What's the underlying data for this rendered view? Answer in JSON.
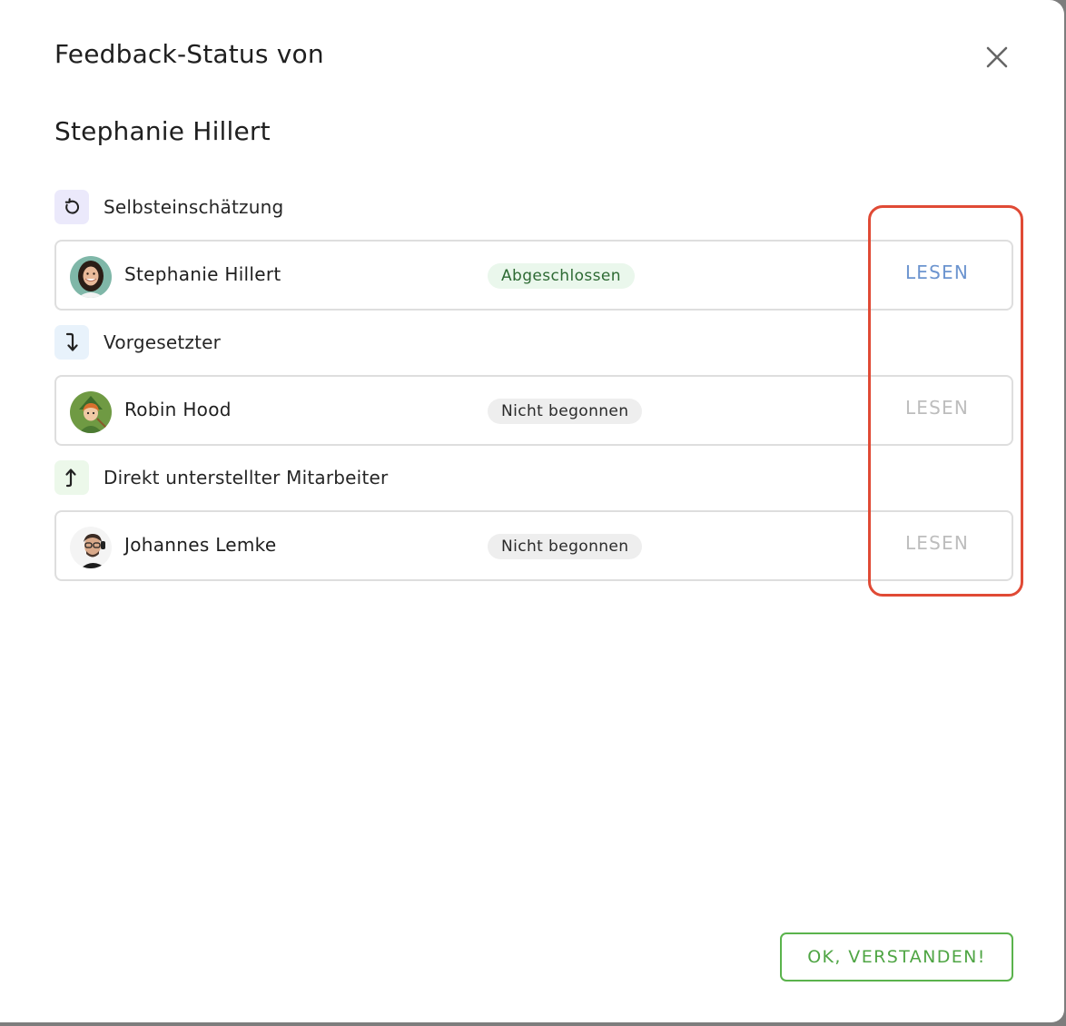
{
  "dialog": {
    "title_line1": "Feedback-Status von",
    "title_line2": "Stephanie Hillert",
    "close_icon": "close-icon"
  },
  "sections": [
    {
      "label": "Selbsteinschätzung",
      "icon": "rotate-ccw-icon",
      "icon_bg": "#ebe9fb",
      "entry": {
        "name": "Stephanie Hillert",
        "status": "Abgeschlossen",
        "status_kind": "completed",
        "action": "LESEN",
        "action_enabled": true
      }
    },
    {
      "label": "Vorgesetzter",
      "icon": "arrow-down-turn-icon",
      "icon_bg": "#e8f2fb",
      "entry": {
        "name": "Robin Hood",
        "status": "Nicht begonnen",
        "status_kind": "not-started",
        "action": "LESEN",
        "action_enabled": false
      }
    },
    {
      "label": "Direkt unterstellter Mitarbeiter",
      "icon": "arrow-up-turn-icon",
      "icon_bg": "#ecf8ea",
      "entry": {
        "name": "Johannes Lemke",
        "status": "Nicht begonnen",
        "status_kind": "not-started",
        "action": "LESEN",
        "action_enabled": false
      }
    }
  ],
  "footer": {
    "confirm_label": "OK, VERSTANDEN!"
  },
  "colors": {
    "action_active": "#6c94cf",
    "action_inactive": "#bdbdbd",
    "confirm_green": "#5ab34c",
    "highlight_red": "#e04a35"
  }
}
